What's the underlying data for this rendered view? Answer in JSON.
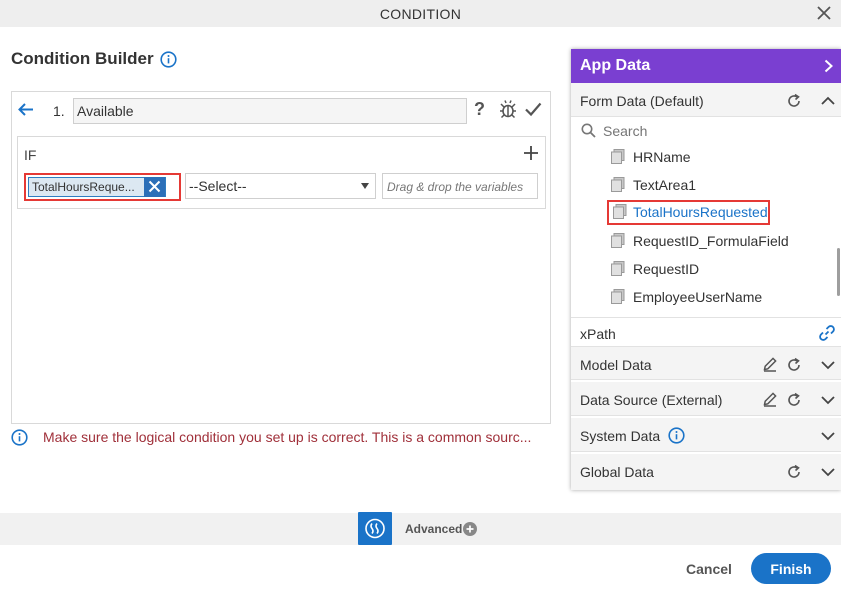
{
  "dialog": {
    "title": "CONDITION"
  },
  "builder": {
    "title": "Condition Builder",
    "condition_number": "1.",
    "condition_name": "Available",
    "if_label": "IF",
    "variable_chip": "TotalHoursReque...",
    "operator_select": "--Select--",
    "drop_placeholder": "Drag & drop the variables",
    "warning": "Make sure the logical condition you set up is correct. This is a common sourc..."
  },
  "advanced": {
    "label": "Advanced"
  },
  "footer": {
    "cancel_label": "Cancel",
    "finish_label": "Finish"
  },
  "app_data": {
    "title": "App Data",
    "form_data_label": "Form Data (Default)",
    "search_placeholder": "Search",
    "items": [
      {
        "label": "HRName"
      },
      {
        "label": "TextArea1"
      },
      {
        "label": "TotalHoursRequested",
        "selected": true
      },
      {
        "label": "RequestID_FormulaField"
      },
      {
        "label": "RequestID"
      },
      {
        "label": "EmployeeUserName"
      }
    ],
    "xpath_label": "xPath",
    "sections": [
      {
        "label": "Model Data",
        "icons": [
          "pencil-icon",
          "refresh-icon",
          "chevron-down-icon"
        ]
      },
      {
        "label": "Data Source (External)",
        "icons": [
          "pencil-icon",
          "refresh-icon",
          "chevron-down-icon"
        ]
      },
      {
        "label": "System Data",
        "icons": [
          "info-icon",
          "chevron-down-icon"
        ]
      },
      {
        "label": "Global Data",
        "icons": [
          "refresh-icon",
          "chevron-down-icon"
        ]
      }
    ]
  },
  "colors": {
    "accent_blue": "#1a73c8",
    "app_data_header": "#7a3fd1",
    "highlight_red": "#e53935",
    "warning_text": "#a0303a"
  }
}
